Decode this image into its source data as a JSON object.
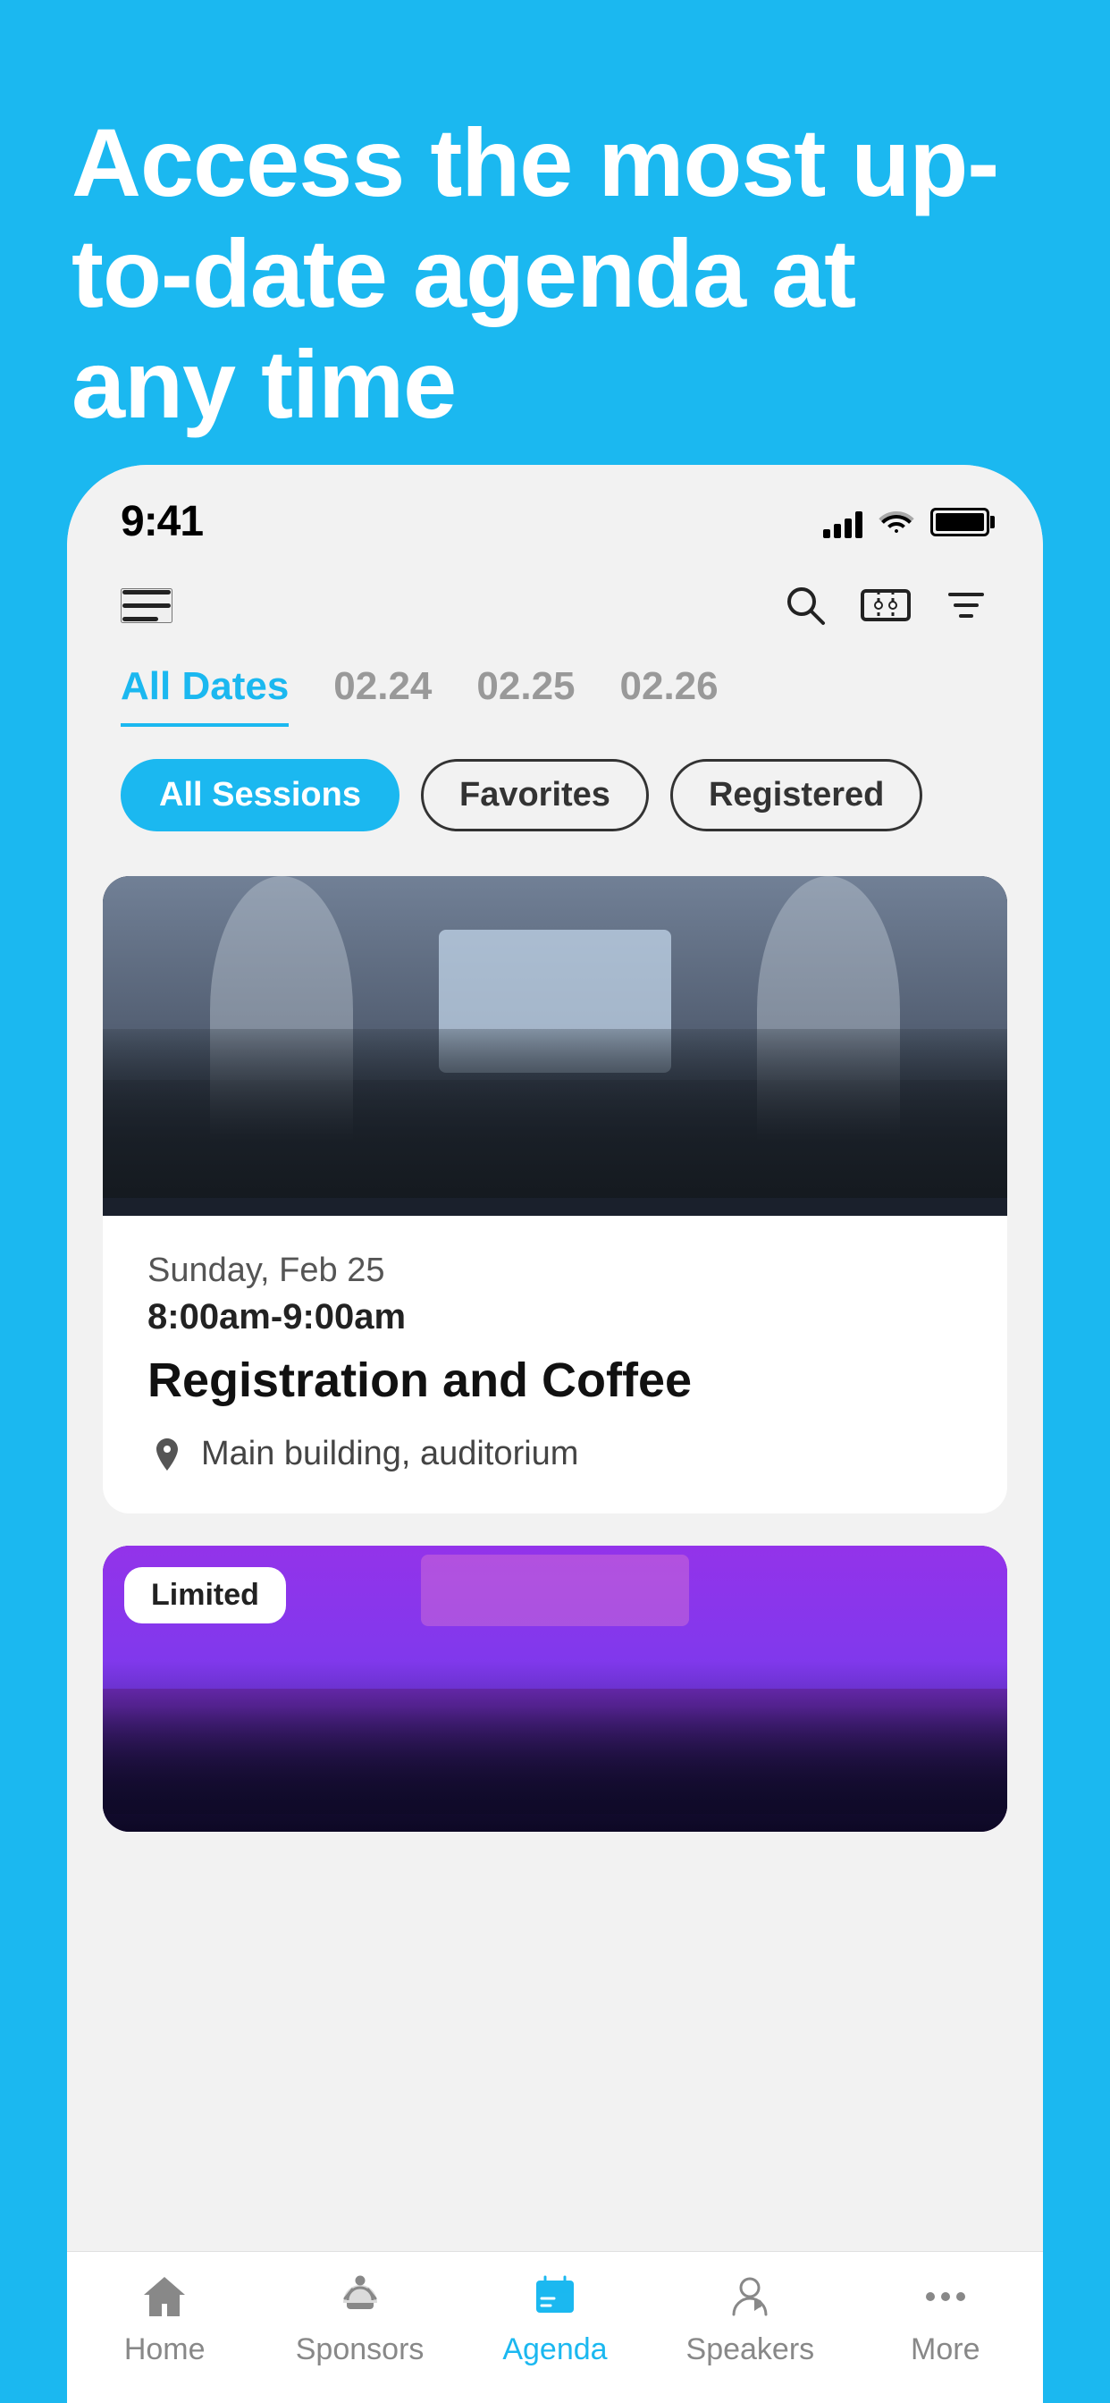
{
  "header": {
    "title": "Access the most up-to-date agenda at any time",
    "background_color": "#1BB8F0"
  },
  "status_bar": {
    "time": "9:41"
  },
  "top_nav": {
    "search_label": "search",
    "ticket_label": "ticket",
    "filter_label": "filter"
  },
  "date_tabs": [
    {
      "label": "All Dates",
      "active": true
    },
    {
      "label": "02.24",
      "active": false
    },
    {
      "label": "02.25",
      "active": false
    },
    {
      "label": "02.26",
      "active": false
    }
  ],
  "session_filters": [
    {
      "label": "All Sessions",
      "active": true
    },
    {
      "label": "Favorites",
      "active": false
    },
    {
      "label": "Registered",
      "active": false
    }
  ],
  "sessions": [
    {
      "date": "Sunday, Feb 25",
      "time": "8:00am-9:00am",
      "title": "Registration and Coffee",
      "location": "Main building, auditorium",
      "badge": null,
      "image_type": "conference"
    },
    {
      "date": "",
      "time": "",
      "title": "",
      "location": "",
      "badge": "Limited",
      "image_type": "audience"
    }
  ],
  "bottom_nav": {
    "items": [
      {
        "label": "Home",
        "active": false,
        "icon": "home-icon"
      },
      {
        "label": "Sponsors",
        "active": false,
        "icon": "sponsors-icon"
      },
      {
        "label": "Agenda",
        "active": true,
        "icon": "agenda-icon"
      },
      {
        "label": "Speakers",
        "active": false,
        "icon": "speakers-icon"
      },
      {
        "label": "More",
        "active": false,
        "icon": "more-icon"
      }
    ]
  }
}
